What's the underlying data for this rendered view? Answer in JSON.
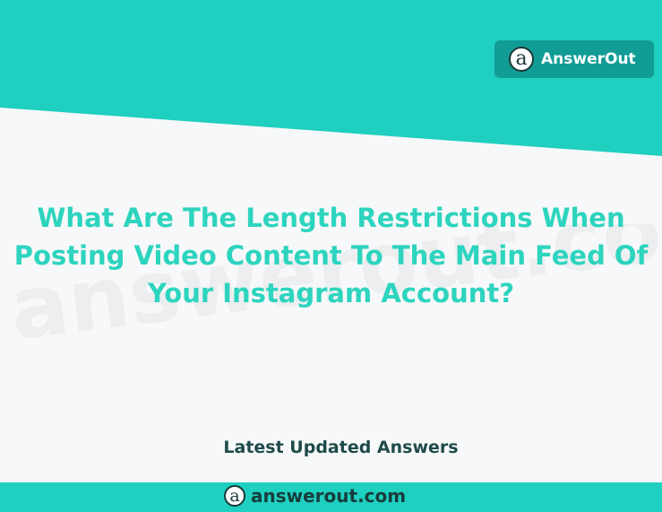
{
  "colors": {
    "teal": "#1fcfc0",
    "badge_bg": "#129c96",
    "question_text": "#2dd4be",
    "dark_text": "#1f4a4a",
    "background": "#f7f8f9"
  },
  "header": {
    "brand_name": "AnswerOut",
    "logo_glyph": "a",
    "logo_icon": "answerout-logo-icon"
  },
  "watermark": {
    "text": "answerout.com"
  },
  "question": {
    "text": "What Are The Length Restrictions When Posting Video Content To The Main Feed Of Your Instagram Account?"
  },
  "section": {
    "latest_label": "Latest Updated Answers"
  },
  "footer": {
    "domain": "answerout.com",
    "logo_glyph": "a",
    "logo_icon": "answerout-logo-icon"
  }
}
